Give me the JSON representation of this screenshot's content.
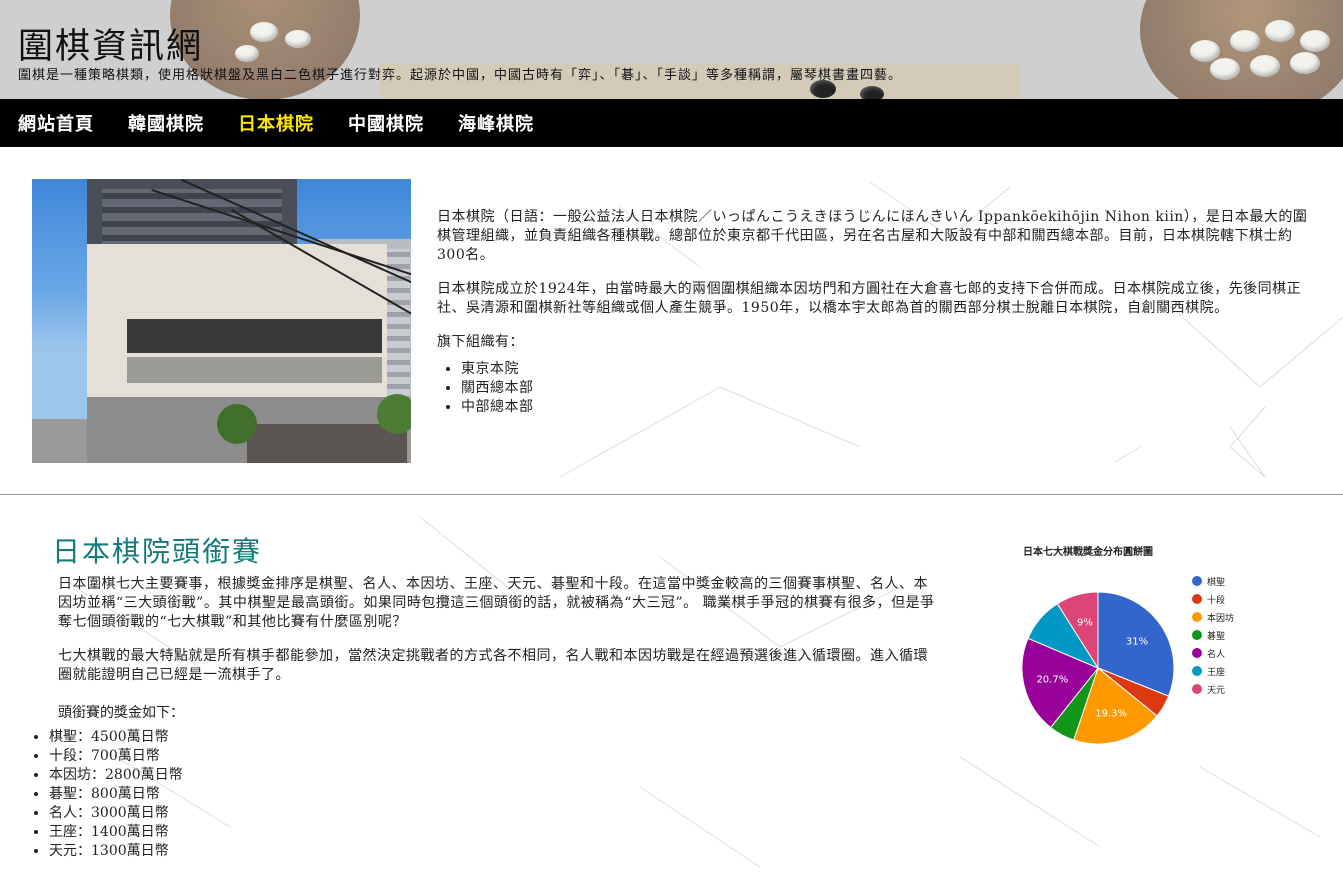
{
  "header": {
    "title": "圍棋資訊網",
    "description": "圍棋是一種策略棋類，使用格狀棋盤及黑白二色棋子進行對弈。起源於中國，中國古時有「弈」、「碁」、「手談」等多種稱謂，屬琴棋書畫四藝。"
  },
  "nav": {
    "items": [
      {
        "label": "網站首頁",
        "active": false
      },
      {
        "label": "韓國棋院",
        "active": false
      },
      {
        "label": "日本棋院",
        "active": true
      },
      {
        "label": "中國棋院",
        "active": false
      },
      {
        "label": "海峰棋院",
        "active": false
      }
    ]
  },
  "intro": {
    "p1": "日本棋院（日語：一般公益法人日本棋院／いっぱんこうえきほうじんにほんきいん Ippankōekihōjin Nihon kiin），是日本最大的圍棋管理組織，並負責組織各種棋戰。總部位於東京都千代田區，另在名古屋和大阪設有中部和關西總本部。目前，日本棋院轄下棋士約300名。",
    "p2": "日本棋院成立於1924年，由當時最大的兩個圍棋組織本因坊門和方圓社在大倉喜七郎的支持下合併而成。日本棋院成立後，先後同棋正社、吳清源和圍棋新社等組織或個人產生競爭。1950年，以橋本宇太郎為首的關西部分棋士脫離日本棋院，自創關西棋院。",
    "sub_label": "旗下組織有：",
    "orgs": [
      "東京本院",
      "關西總本部",
      "中部總本部"
    ]
  },
  "section2": {
    "title": "日本棋院頭銜賽",
    "p1": "日本圍棋七大主要賽事，根據獎金排序是棋聖、名人、本因坊、王座、天元、碁聖和十段。在這當中獎金較高的三個賽事棋聖、名人、本因坊並稱“三大頭銜戰”。其中棋聖是最高頭銜。如果同時包攬這三個頭銜的話，就被稱為“大三冠”。 職業棋手爭冠的棋賽有很多，但是爭奪七個頭銜戰的“七大棋戰”和其他比賽有什麼區別呢？",
    "p2": "七大棋戰的最大特點就是所有棋手都能參加，當然決定挑戰者的方式各不相同，名人戰和本因坊戰是在經過預選後進入循環圈。進入循環圈就能證明自己已經是一流棋手了。",
    "prize_label": "頭銜賽的獎金如下：",
    "prizes": [
      "棋聖：4500萬日幣",
      "十段：700萬日幣",
      "本因坊：2800萬日幣",
      "碁聖：800萬日幣",
      "名人：3000萬日幣",
      "王座：1400萬日幣",
      "天元：1300萬日幣"
    ]
  },
  "chart_data": {
    "type": "pie",
    "title": "日本七大棋戰獎金分布圓餅圖",
    "categories": [
      "棋聖",
      "十段",
      "本因坊",
      "碁聖",
      "名人",
      "王座",
      "天元"
    ],
    "values": [
      4500,
      700,
      2800,
      800,
      3000,
      1400,
      1300
    ],
    "colors": [
      "#3366cc",
      "#dc3912",
      "#ff9900",
      "#109618",
      "#990099",
      "#0099c6",
      "#dd4477"
    ],
    "slice_labels": [
      "31%",
      "",
      "19.3%",
      "",
      "20.7%",
      "",
      "9%"
    ],
    "legend": "right"
  }
}
